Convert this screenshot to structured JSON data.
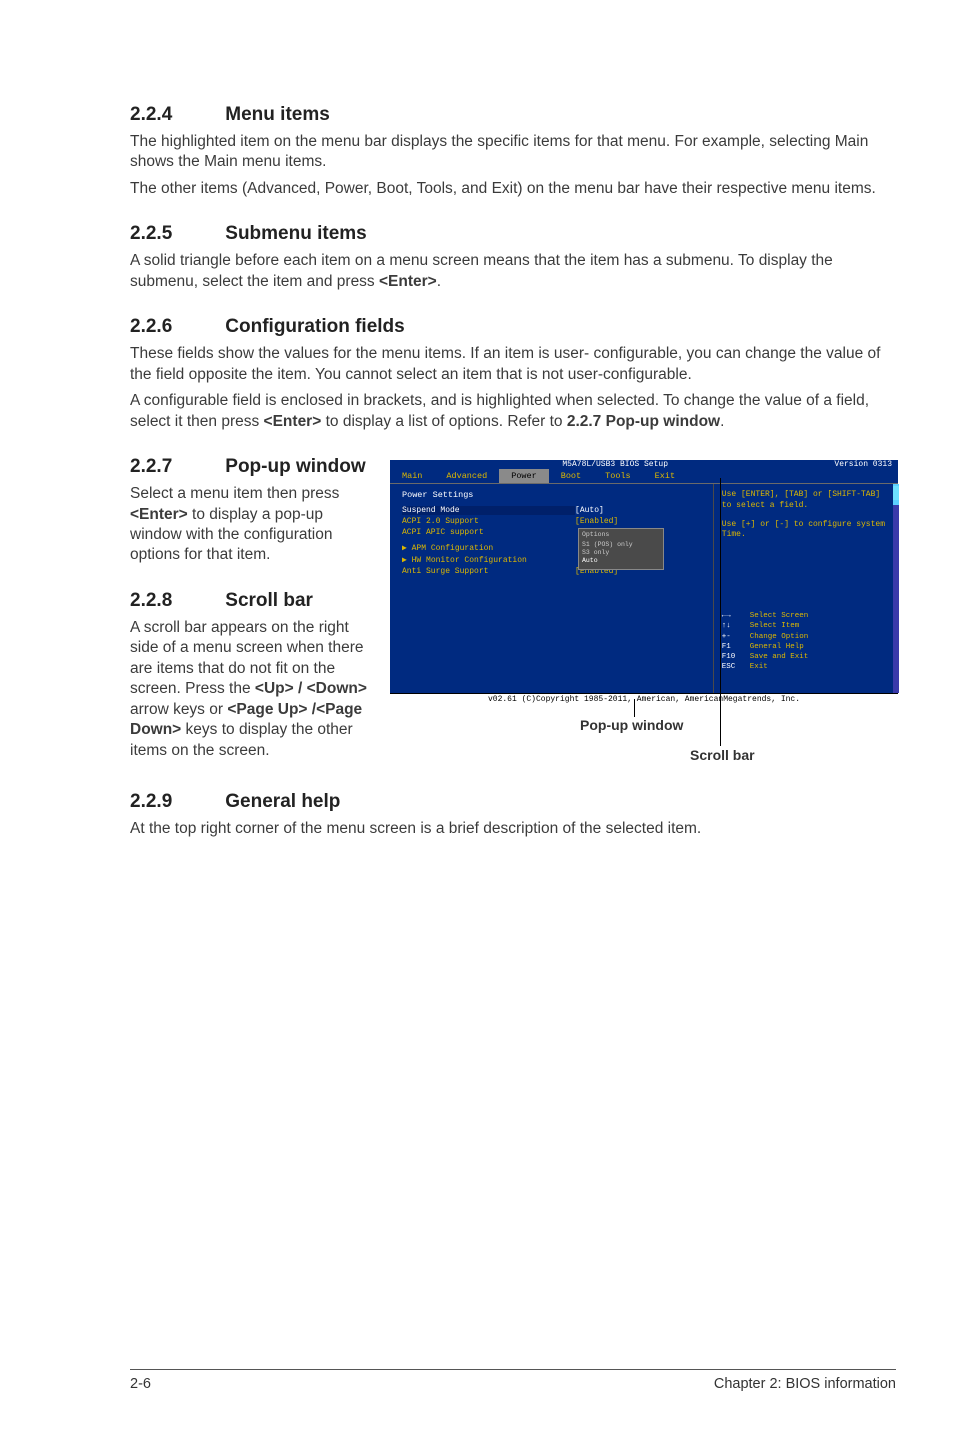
{
  "sections": {
    "s224": {
      "num": "2.2.4",
      "title": "Menu items"
    },
    "s224_p1": "The highlighted item on the menu bar displays the specific items for that menu. For example, selecting Main shows the Main menu items.",
    "s224_p2": "The other items (Advanced, Power, Boot, Tools, and Exit) on the menu bar have their respective menu items.",
    "s225": {
      "num": "2.2.5",
      "title": "Submenu items"
    },
    "s225_p1a": "A solid triangle before each item on a menu screen means that the item has a submenu. To display the submenu, select the item and press ",
    "s225_p1b": "<Enter>",
    "s225_p1c": ".",
    "s226": {
      "num": "2.2.6",
      "title": "Configuration fields"
    },
    "s226_p1": "These fields show the values for the menu items. If an item is user- configurable, you can change the value of the field opposite the item. You cannot select an item that is not user-configurable.",
    "s226_p2a": "A configurable field is enclosed in brackets, and is highlighted when selected. To change the value of a field, select it then press ",
    "s226_p2b": "<Enter>",
    "s226_p2c": " to display a list of options. Refer to ",
    "s226_p2d": "2.2.7 Pop-up window",
    "s226_p2e": ".",
    "s227": {
      "num": "2.2.7",
      "title": "Pop-up window"
    },
    "s227_p1a": "Select a menu item then press ",
    "s227_p1b": "<Enter>",
    "s227_p1c": " to display a pop-up window with the configuration options for that item.",
    "s228": {
      "num": "2.2.8",
      "title": "Scroll bar"
    },
    "s228_p1a": "A scroll bar appears on the right side of a menu screen when there are items that do not fit on the screen. Press the ",
    "s228_p1b": "<Up> / <Down>",
    "s228_p1c": " arrow keys or ",
    "s228_p1d": "<Page Up> /<Page Down>",
    "s228_p1e": " keys to display the other items on the screen.",
    "s229": {
      "num": "2.2.9",
      "title": "General help"
    },
    "s229_p1": "At the top right corner of the menu screen is a brief description of the selected item."
  },
  "bios": {
    "title": "M5A78L/USB3 BIOS Setup",
    "version": "Version 0313",
    "menu": [
      "Main",
      "Advanced",
      "Power",
      "Boot",
      "Tools",
      "Exit"
    ],
    "panel_header": "Power Settings",
    "rows": [
      {
        "label": "Suspend Mode",
        "value": "[Auto]",
        "sel": true
      },
      {
        "label": "ACPI 2.0 Support",
        "value": "[Enabled]"
      },
      {
        "label": "ACPI APIC support",
        "value": ""
      },
      {
        "label": "▶ APM Configuration",
        "value": ""
      },
      {
        "label": "▶ HW Monitor Configuration",
        "value": ""
      },
      {
        "label": "Anti Surge Support",
        "value": "[Enabled]"
      }
    ],
    "popup": {
      "title": "Options",
      "opts": [
        "S1 (POS) only",
        "S3 only",
        "Auto"
      ]
    },
    "help1": "Use [ENTER], [TAB] or [SHIFT-TAB] to select a field.",
    "help2": "Use [+] or [-] to configure system Time.",
    "nav": [
      {
        "k": "←→",
        "t": "Select Screen"
      },
      {
        "k": "↑↓",
        "t": "Select Item"
      },
      {
        "k": "+-",
        "t": "Change Option"
      },
      {
        "k": "F1",
        "t": "General Help"
      },
      {
        "k": "F10",
        "t": "Save and Exit"
      },
      {
        "k": "ESC",
        "t": "Exit"
      }
    ],
    "copyright": "v02.61 (C)Copyright 1985-2011, American, AmericanMegatrends, Inc."
  },
  "callouts": {
    "popup": "Pop-up window",
    "scrollbar": "Scroll bar"
  },
  "footer": {
    "page": "2-6",
    "chapter": "Chapter 2: BIOS information"
  }
}
